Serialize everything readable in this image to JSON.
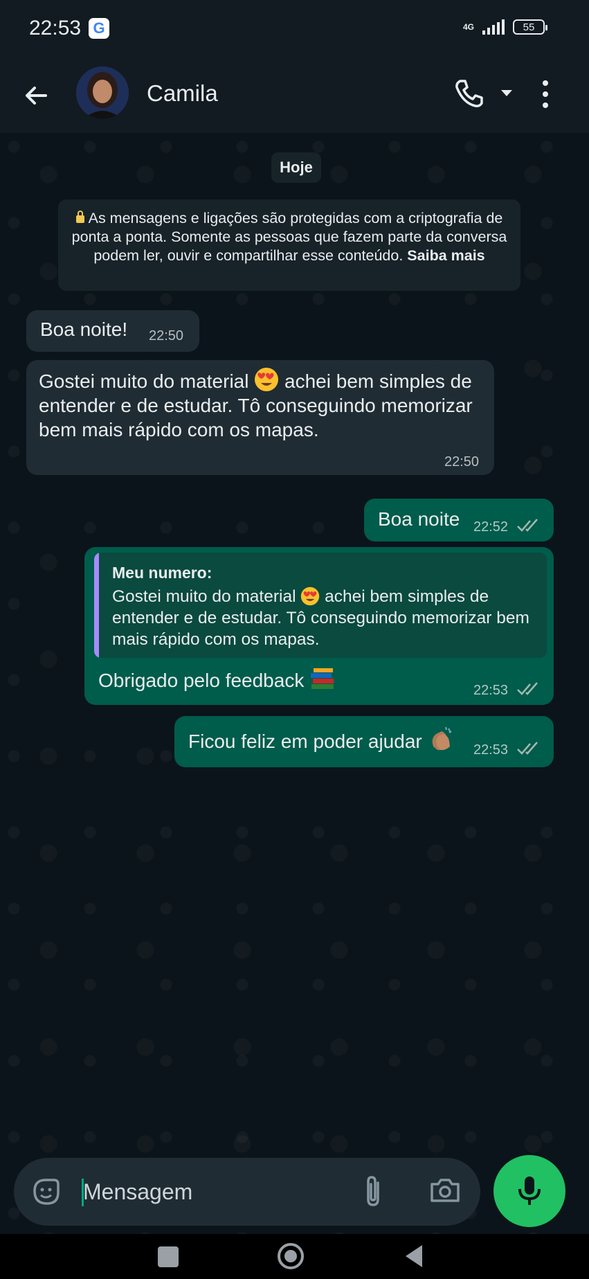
{
  "status_bar": {
    "time": "22:53",
    "network": "4G",
    "battery": "55"
  },
  "header": {
    "contact_name": "Camila",
    "icons": [
      "back-arrow-icon",
      "phone-icon",
      "chevron-down-icon",
      "more-vertical-icon"
    ]
  },
  "chat": {
    "date_label": "Hoje",
    "encryption_notice": {
      "text": "As mensagens e ligações são protegidas com a criptografia de ponta a ponta. Somente as pessoas que fazem parte da conversa podem ler, ouvir e compartilhar esse conteúdo.",
      "link": "Saiba mais"
    },
    "messages": [
      {
        "direction": "in",
        "text": "Boa noite!",
        "time": "22:50"
      },
      {
        "direction": "in",
        "text_before": "Gostei muito do material",
        "text_after": "achei bem simples de entender e de estudar. Tô conseguindo memorizar bem mais rápido com os mapas.",
        "time": "22:50"
      },
      {
        "direction": "out",
        "text": "Boa noite",
        "time": "22:52"
      },
      {
        "direction": "out",
        "quote": {
          "author": "Meu numero:",
          "text_before": "Gostei muito do material",
          "text_after": "achei bem simples de entender e de estudar. Tô conseguindo memorizar bem mais rápido com os mapas."
        },
        "text": "Obrigado pelo feedback",
        "time": "22:53"
      },
      {
        "direction": "out",
        "text": "Ficou feliz em poder ajudar",
        "time": "22:53"
      }
    ]
  },
  "composer": {
    "placeholder": "Mensagem"
  },
  "colors": {
    "background": "#0b141a",
    "incoming_bubble": "#202c33",
    "outgoing_bubble": "#005c4b",
    "accent": "#21c063"
  }
}
